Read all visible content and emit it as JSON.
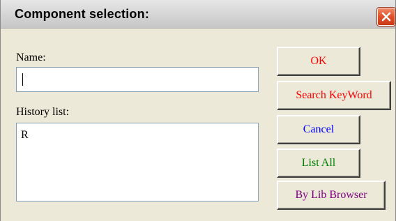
{
  "dialog": {
    "title": "Component selection:"
  },
  "name_field": {
    "label": "Name:",
    "value": ""
  },
  "history": {
    "label": "History list:",
    "items": [
      "R"
    ]
  },
  "buttons": {
    "ok": {
      "label": "OK",
      "color": "#ff0000"
    },
    "search_keyword": {
      "label": "Search KeyWord",
      "color": "#ff0000"
    },
    "cancel": {
      "label": "Cancel",
      "color": "#0000ff"
    },
    "list_all": {
      "label": "List All",
      "color": "#008000"
    },
    "by_lib_browser": {
      "label": "By Lib Browser",
      "color": "#800080"
    }
  },
  "icons": {
    "close": "close-icon"
  }
}
